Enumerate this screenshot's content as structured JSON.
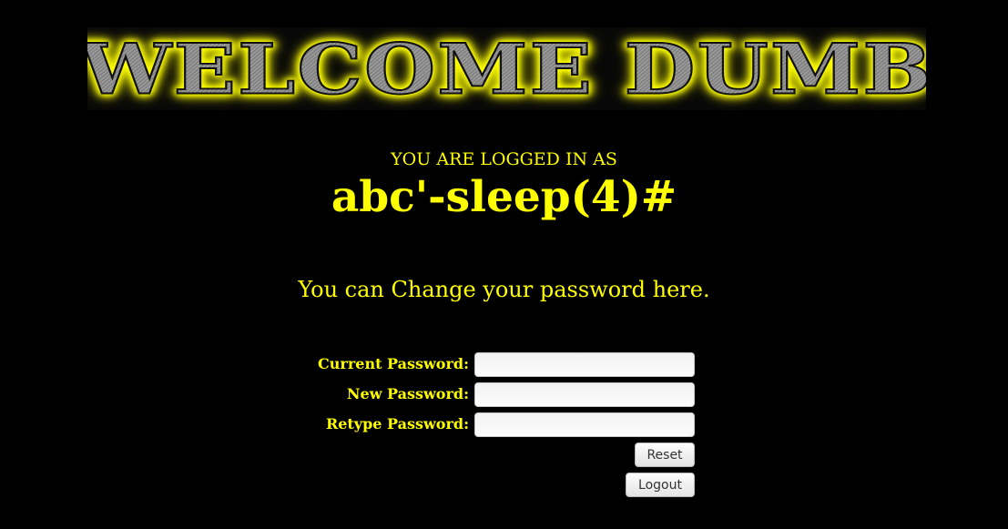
{
  "banner": {
    "text": "WELCOME DUMB"
  },
  "session": {
    "logged_in_label": "YOU ARE LOGGED IN AS",
    "username": "abc'-sleep(4)#"
  },
  "change_password": {
    "message": "You can Change your password here.",
    "fields": [
      {
        "label": "Current Password:",
        "value": "",
        "placeholder": ""
      },
      {
        "label": "New Password:",
        "value": "",
        "placeholder": ""
      },
      {
        "label": "Retype Password:",
        "value": "",
        "placeholder": ""
      }
    ],
    "reset_label": "Reset",
    "logout_label": "Logout"
  },
  "colors": {
    "background": "#000000",
    "text": "#ffff00",
    "banner_glow": "#ffff00",
    "banner_metal": "#9e9e9e"
  }
}
